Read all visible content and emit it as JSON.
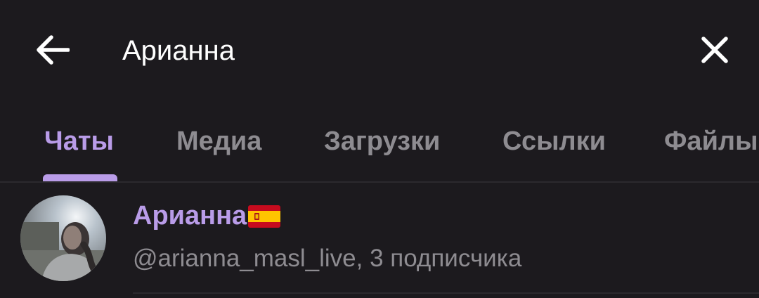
{
  "search": {
    "query": "Арианна"
  },
  "tabs": [
    {
      "label": "Чаты",
      "active": true
    },
    {
      "label": "Медиа",
      "active": false
    },
    {
      "label": "Загрузки",
      "active": false
    },
    {
      "label": "Ссылки",
      "active": false
    },
    {
      "label": "Файлы",
      "active": false
    }
  ],
  "results": [
    {
      "name": "Арианна",
      "flag_icon": "spain-flag-icon",
      "subtitle": "@arianna_masl_live, 3 подписчика"
    }
  ],
  "colors": {
    "background": "#1c1a1e",
    "accent": "#b99ce8",
    "muted_text": "#8e8c91",
    "divider": "#2b292e"
  }
}
